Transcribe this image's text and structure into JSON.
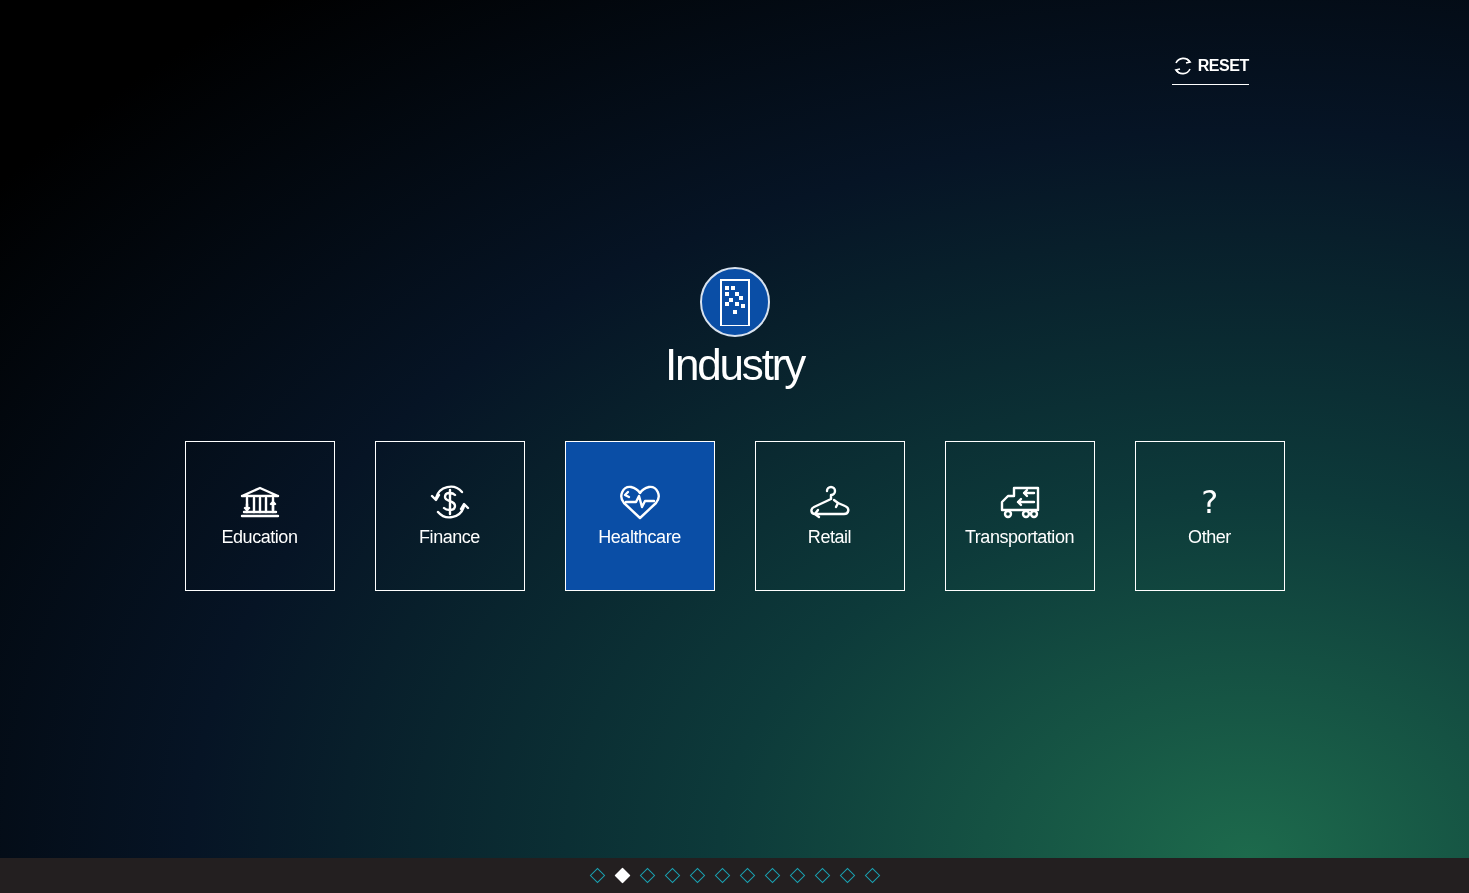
{
  "reset_button": {
    "label": "RESET"
  },
  "header": {
    "title": "Industry"
  },
  "options": [
    {
      "label": "Education",
      "kind": "bank",
      "selected": false
    },
    {
      "label": "Finance",
      "kind": "money",
      "selected": false
    },
    {
      "label": "Healthcare",
      "kind": "heart",
      "selected": true
    },
    {
      "label": "Retail",
      "kind": "hanger",
      "selected": false
    },
    {
      "label": "Transportation",
      "kind": "truck",
      "selected": false
    },
    {
      "label": "Other",
      "kind": "glyph",
      "glyph": "?",
      "selected": false
    }
  ],
  "pager": [
    {
      "selected": false
    },
    {
      "selected": true
    },
    {
      "selected": false
    },
    {
      "selected": false
    },
    {
      "selected": false
    },
    {
      "selected": false
    },
    {
      "selected": false
    },
    {
      "selected": false
    },
    {
      "selected": false
    },
    {
      "selected": false
    },
    {
      "selected": false
    },
    {
      "selected": false
    }
  ]
}
